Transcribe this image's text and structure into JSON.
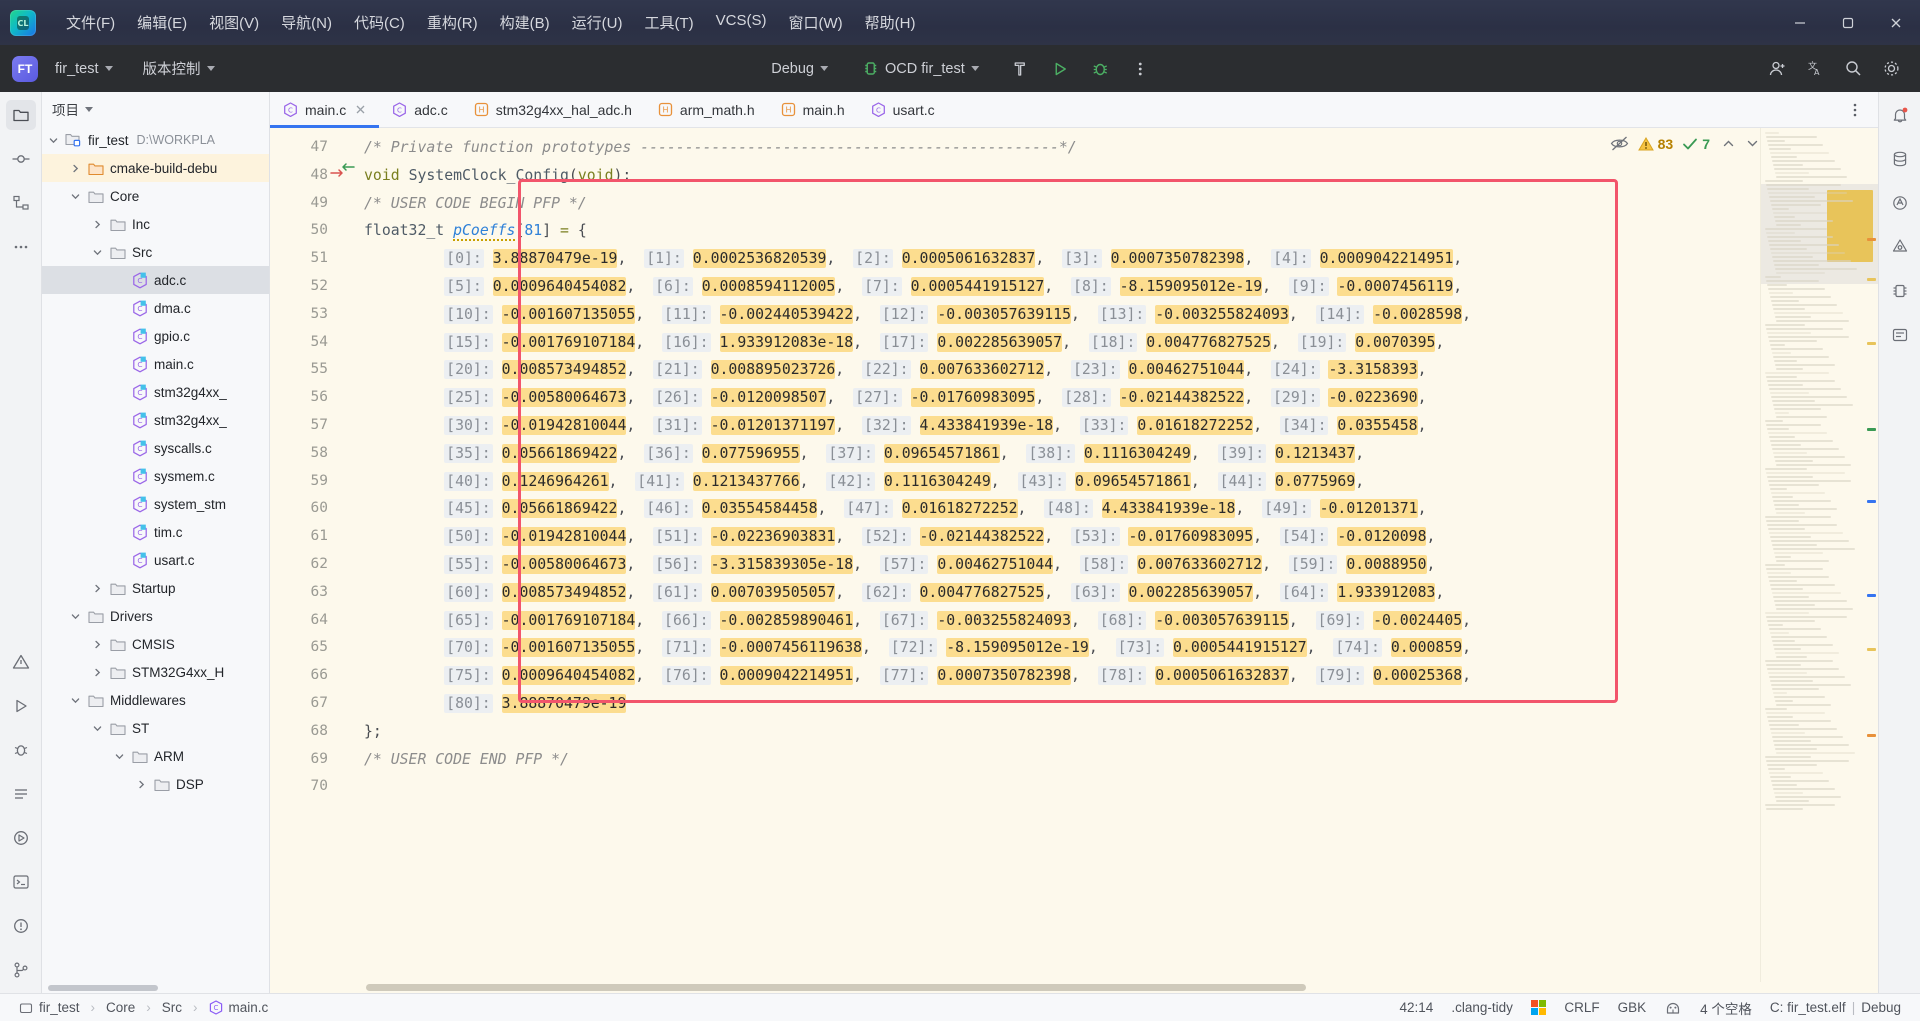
{
  "window": {
    "minimize": "—",
    "maximize": "▢",
    "close": "✕"
  },
  "menubar": {
    "logo_text": "CL",
    "items": [
      {
        "label": "文件(F)",
        "mnemonic": "F"
      },
      {
        "label": "编辑(E)",
        "mnemonic": "E"
      },
      {
        "label": "视图(V)",
        "mnemonic": "V"
      },
      {
        "label": "导航(N)",
        "mnemonic": "N"
      },
      {
        "label": "代码(C)",
        "mnemonic": "C"
      },
      {
        "label": "重构(R)",
        "mnemonic": "R"
      },
      {
        "label": "构建(B)",
        "mnemonic": "B"
      },
      {
        "label": "运行(U)",
        "mnemonic": "U"
      },
      {
        "label": "工具(T)",
        "mnemonic": "T"
      },
      {
        "label": "VCS(S)",
        "mnemonic": "S"
      },
      {
        "label": "窗口(W)",
        "mnemonic": "W"
      },
      {
        "label": "帮助(H)",
        "mnemonic": "H"
      }
    ]
  },
  "toolbar": {
    "project_badge": "FT",
    "project_name": "fir_test",
    "vcs_label": "版本控制",
    "build_config": "Debug",
    "run_config": "OCD fir_test",
    "icons": {
      "hammer": "build-icon",
      "run": "run-icon",
      "debug": "debug-icon",
      "more": "more-vertical-icon",
      "account": "account-icon",
      "translate": "translate-icon",
      "search": "search-icon",
      "settings": "settings-icon"
    }
  },
  "sidebar": {
    "title": "项目",
    "tree": [
      {
        "depth": 0,
        "twist": "v",
        "icon": "project-folder",
        "label": "fir_test",
        "path": "D:\\WORKPLA",
        "state": "normal"
      },
      {
        "depth": 1,
        "twist": ">",
        "icon": "folder-orange",
        "label": "cmake-build-debu",
        "path": "",
        "state": "highlight"
      },
      {
        "depth": 1,
        "twist": "v",
        "icon": "folder",
        "label": "Core",
        "path": "",
        "state": "normal"
      },
      {
        "depth": 2,
        "twist": ">",
        "icon": "folder",
        "label": "Inc",
        "path": "",
        "state": "normal"
      },
      {
        "depth": 2,
        "twist": "v",
        "icon": "folder",
        "label": "Src",
        "path": "",
        "state": "normal"
      },
      {
        "depth": 3,
        "twist": "",
        "icon": "c-file",
        "label": "adc.c",
        "path": "",
        "state": "selected"
      },
      {
        "depth": 3,
        "twist": "",
        "icon": "c-file",
        "label": "dma.c",
        "path": "",
        "state": "normal"
      },
      {
        "depth": 3,
        "twist": "",
        "icon": "c-file",
        "label": "gpio.c",
        "path": "",
        "state": "normal"
      },
      {
        "depth": 3,
        "twist": "",
        "icon": "c-file",
        "label": "main.c",
        "path": "",
        "state": "normal"
      },
      {
        "depth": 3,
        "twist": "",
        "icon": "c-file",
        "label": "stm32g4xx_",
        "path": "",
        "state": "normal"
      },
      {
        "depth": 3,
        "twist": "",
        "icon": "c-file",
        "label": "stm32g4xx_",
        "path": "",
        "state": "normal"
      },
      {
        "depth": 3,
        "twist": "",
        "icon": "c-file",
        "label": "syscalls.c",
        "path": "",
        "state": "normal"
      },
      {
        "depth": 3,
        "twist": "",
        "icon": "c-file",
        "label": "sysmem.c",
        "path": "",
        "state": "normal"
      },
      {
        "depth": 3,
        "twist": "",
        "icon": "c-file",
        "label": "system_stm",
        "path": "",
        "state": "normal"
      },
      {
        "depth": 3,
        "twist": "",
        "icon": "c-file",
        "label": "tim.c",
        "path": "",
        "state": "normal"
      },
      {
        "depth": 3,
        "twist": "",
        "icon": "c-file",
        "label": "usart.c",
        "path": "",
        "state": "normal"
      },
      {
        "depth": 2,
        "twist": ">",
        "icon": "folder",
        "label": "Startup",
        "path": "",
        "state": "normal"
      },
      {
        "depth": 1,
        "twist": "v",
        "icon": "folder",
        "label": "Drivers",
        "path": "",
        "state": "normal"
      },
      {
        "depth": 2,
        "twist": ">",
        "icon": "folder",
        "label": "CMSIS",
        "path": "",
        "state": "normal"
      },
      {
        "depth": 2,
        "twist": ">",
        "icon": "folder",
        "label": "STM32G4xx_H",
        "path": "",
        "state": "normal"
      },
      {
        "depth": 1,
        "twist": "v",
        "icon": "folder",
        "label": "Middlewares",
        "path": "",
        "state": "normal"
      },
      {
        "depth": 2,
        "twist": "v",
        "icon": "folder",
        "label": "ST",
        "path": "",
        "state": "normal"
      },
      {
        "depth": 3,
        "twist": "v",
        "icon": "folder",
        "label": "ARM",
        "path": "",
        "state": "normal"
      },
      {
        "depth": 4,
        "twist": ">",
        "icon": "folder",
        "label": "DSP",
        "path": "",
        "state": "normal"
      }
    ]
  },
  "tabs": [
    {
      "label": "main.c",
      "icon": "c-file-icon",
      "active": true,
      "closable": true
    },
    {
      "label": "adc.c",
      "icon": "c-file-icon",
      "active": false,
      "closable": false
    },
    {
      "label": "stm32g4xx_hal_adc.h",
      "icon": "h-file-icon",
      "active": false,
      "closable": false
    },
    {
      "label": "arm_math.h",
      "icon": "h-file-icon",
      "active": false,
      "closable": false
    },
    {
      "label": "main.h",
      "icon": "h-file-icon",
      "active": false,
      "closable": false
    },
    {
      "label": "usart.c",
      "icon": "c-file-icon",
      "active": false,
      "closable": false
    }
  ],
  "inspection": {
    "eye_icon": "eye-off-icon",
    "warning_count": "83",
    "ok_count": "7",
    "prev_icon": "chevron-up-icon",
    "next_icon": "chevron-down-icon"
  },
  "editor": {
    "first_line": 47,
    "lines": [
      {
        "n": 47,
        "marks": "",
        "type": "comment",
        "text": "/* Private function prototypes -----------------------------------------------*/"
      },
      {
        "n": 48,
        "marks": "arrows",
        "type": "code",
        "text": "void SystemClock_Config(void);"
      },
      {
        "n": 49,
        "marks": "",
        "type": "comment",
        "text": "/* USER CODE BEGIN PFP */"
      },
      {
        "n": 50,
        "marks": "",
        "type": "decl",
        "text": "float32_t pCoeffs[81] = {"
      },
      {
        "n": 51,
        "marks": "",
        "type": "coeff",
        "items": [
          {
            "i": "0",
            "v": "3.88870479e-19"
          },
          {
            "i": "1",
            "v": "0.0002536820539"
          },
          {
            "i": "2",
            "v": "0.0005061632837"
          },
          {
            "i": "3",
            "v": "0.0007350782398"
          },
          {
            "i": "4",
            "v": "0.0009042214951"
          }
        ]
      },
      {
        "n": 52,
        "marks": "",
        "type": "coeff",
        "items": [
          {
            "i": "5",
            "v": "0.0009640454082"
          },
          {
            "i": "6",
            "v": "0.0008594112005"
          },
          {
            "i": "7",
            "v": "0.0005441915127"
          },
          {
            "i": "8",
            "v": "-8.159095012e-19"
          },
          {
            "i": "9",
            "v": "-0.0007456119"
          }
        ]
      },
      {
        "n": 53,
        "marks": "",
        "type": "coeff",
        "items": [
          {
            "i": "10",
            "v": "-0.001607135055"
          },
          {
            "i": "11",
            "v": "-0.002440539422"
          },
          {
            "i": "12",
            "v": "-0.003057639115"
          },
          {
            "i": "13",
            "v": "-0.003255824093"
          },
          {
            "i": "14",
            "v": "-0.0028598"
          }
        ]
      },
      {
        "n": 54,
        "marks": "",
        "type": "coeff",
        "items": [
          {
            "i": "15",
            "v": "-0.001769107184"
          },
          {
            "i": "16",
            "v": "1.933912083e-18"
          },
          {
            "i": "17",
            "v": "0.002285639057"
          },
          {
            "i": "18",
            "v": "0.004776827525"
          },
          {
            "i": "19",
            "v": "0.0070395"
          }
        ]
      },
      {
        "n": 55,
        "marks": "",
        "type": "coeff",
        "items": [
          {
            "i": "20",
            "v": "0.008573494852"
          },
          {
            "i": "21",
            "v": "0.008895023726"
          },
          {
            "i": "22",
            "v": "0.007633602712"
          },
          {
            "i": "23",
            "v": "0.00462751044"
          },
          {
            "i": "24",
            "v": "-3.3158393"
          }
        ]
      },
      {
        "n": 56,
        "marks": "",
        "type": "coeff",
        "items": [
          {
            "i": "25",
            "v": "-0.00580064673"
          },
          {
            "i": "26",
            "v": "-0.0120098507"
          },
          {
            "i": "27",
            "v": "-0.01760983095"
          },
          {
            "i": "28",
            "v": "-0.02144382522"
          },
          {
            "i": "29",
            "v": "-0.0223690"
          }
        ]
      },
      {
        "n": 57,
        "marks": "",
        "type": "coeff",
        "items": [
          {
            "i": "30",
            "v": "-0.01942810044"
          },
          {
            "i": "31",
            "v": "-0.01201371197"
          },
          {
            "i": "32",
            "v": "4.433841939e-18"
          },
          {
            "i": "33",
            "v": "0.01618272252"
          },
          {
            "i": "34",
            "v": "0.0355458"
          }
        ]
      },
      {
        "n": 58,
        "marks": "",
        "type": "coeff",
        "items": [
          {
            "i": "35",
            "v": "0.05661869422"
          },
          {
            "i": "36",
            "v": "0.077596955"
          },
          {
            "i": "37",
            "v": "0.09654571861"
          },
          {
            "i": "38",
            "v": "0.1116304249"
          },
          {
            "i": "39",
            "v": "0.1213437"
          }
        ]
      },
      {
        "n": 59,
        "marks": "",
        "type": "coeff",
        "items": [
          {
            "i": "40",
            "v": "0.1246964261"
          },
          {
            "i": "41",
            "v": "0.1213437766"
          },
          {
            "i": "42",
            "v": "0.1116304249"
          },
          {
            "i": "43",
            "v": "0.09654571861"
          },
          {
            "i": "44",
            "v": "0.0775969"
          }
        ]
      },
      {
        "n": 60,
        "marks": "",
        "type": "coeff",
        "items": [
          {
            "i": "45",
            "v": "0.05661869422"
          },
          {
            "i": "46",
            "v": "0.03554584458"
          },
          {
            "i": "47",
            "v": "0.01618272252"
          },
          {
            "i": "48",
            "v": "4.433841939e-18"
          },
          {
            "i": "49",
            "v": "-0.01201371"
          }
        ]
      },
      {
        "n": 61,
        "marks": "",
        "type": "coeff",
        "items": [
          {
            "i": "50",
            "v": "-0.01942810044"
          },
          {
            "i": "51",
            "v": "-0.02236903831"
          },
          {
            "i": "52",
            "v": "-0.02144382522"
          },
          {
            "i": "53",
            "v": "-0.01760983095"
          },
          {
            "i": "54",
            "v": "-0.0120098"
          }
        ]
      },
      {
        "n": 62,
        "marks": "",
        "type": "coeff",
        "items": [
          {
            "i": "55",
            "v": "-0.00580064673"
          },
          {
            "i": "56",
            "v": "-3.315839305e-18"
          },
          {
            "i": "57",
            "v": "0.00462751044"
          },
          {
            "i": "58",
            "v": "0.007633602712"
          },
          {
            "i": "59",
            "v": "0.0088950"
          }
        ]
      },
      {
        "n": 63,
        "marks": "",
        "type": "coeff",
        "items": [
          {
            "i": "60",
            "v": "0.008573494852"
          },
          {
            "i": "61",
            "v": "0.007039505057"
          },
          {
            "i": "62",
            "v": "0.004776827525"
          },
          {
            "i": "63",
            "v": "0.002285639057"
          },
          {
            "i": "64",
            "v": "1.933912083"
          }
        ]
      },
      {
        "n": 64,
        "marks": "",
        "type": "coeff",
        "items": [
          {
            "i": "65",
            "v": "-0.001769107184"
          },
          {
            "i": "66",
            "v": "-0.002859890461"
          },
          {
            "i": "67",
            "v": "-0.003255824093"
          },
          {
            "i": "68",
            "v": "-0.003057639115"
          },
          {
            "i": "69",
            "v": "-0.0024405"
          }
        ]
      },
      {
        "n": 65,
        "marks": "",
        "type": "coeff",
        "items": [
          {
            "i": "70",
            "v": "-0.001607135055"
          },
          {
            "i": "71",
            "v": "-0.0007456119638"
          },
          {
            "i": "72",
            "v": "-8.159095012e-19"
          },
          {
            "i": "73",
            "v": "0.0005441915127"
          },
          {
            "i": "74",
            "v": "0.000859"
          }
        ]
      },
      {
        "n": 66,
        "marks": "",
        "type": "coeff",
        "items": [
          {
            "i": "75",
            "v": "0.0009640454082"
          },
          {
            "i": "76",
            "v": "0.0009042214951"
          },
          {
            "i": "77",
            "v": "0.0007350782398"
          },
          {
            "i": "78",
            "v": "0.0005061632837"
          },
          {
            "i": "79",
            "v": "0.00025368"
          }
        ]
      },
      {
        "n": 67,
        "marks": "",
        "type": "coeff",
        "items": [
          {
            "i": "80",
            "v": "3.88870479e-19"
          }
        ]
      },
      {
        "n": 68,
        "marks": "",
        "type": "code",
        "text": "};"
      },
      {
        "n": 69,
        "marks": "",
        "type": "comment",
        "text": "/* USER CODE END PFP */"
      },
      {
        "n": 70,
        "marks": "",
        "type": "code",
        "text": ""
      }
    ]
  },
  "statusbar": {
    "breadcrumb": [
      {
        "label": "fir_test",
        "icon": "project-icon"
      },
      {
        "label": "Core",
        "icon": ""
      },
      {
        "label": "Src",
        "icon": ""
      },
      {
        "label": "main.c",
        "icon": "c-file-icon"
      }
    ],
    "caret": "42:14",
    "inspection_profile": ".clang-tidy",
    "os_icon": "windows-icon",
    "line_separator": "CRLF",
    "encoding": "GBK",
    "toolchain_icon": "toolchain-icon",
    "indent": "4 个空格",
    "target": "C: fir_test.elf",
    "separator": "|",
    "config": "Debug"
  },
  "colors": {
    "accent": "#3574f0",
    "highlight_box": "#f2556b",
    "hint_bg": "#fcdd8f",
    "editor_bg": "#fdf9ec",
    "warning": "#b68100",
    "ok": "#3a9a54"
  }
}
